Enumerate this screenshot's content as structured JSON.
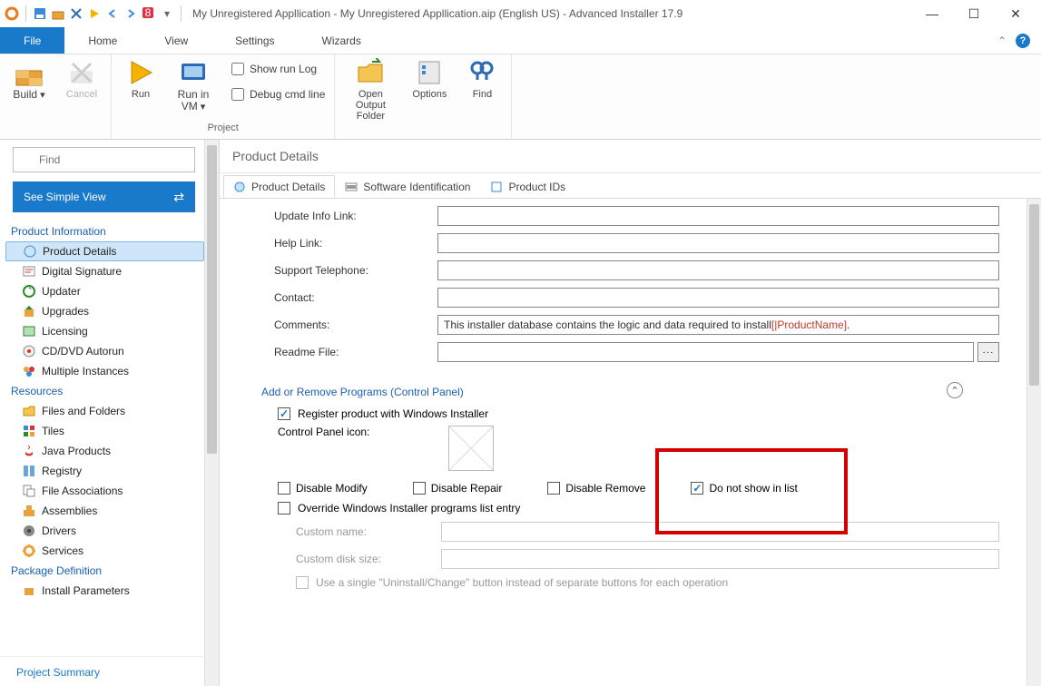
{
  "window": {
    "title": "My Unregistered Appllication - My Unregistered Appllication.aip (English US) - Advanced Installer 17.9"
  },
  "menubar": {
    "file": "File",
    "home": "Home",
    "view": "View",
    "settings": "Settings",
    "wizards": "Wizards"
  },
  "ribbon": {
    "build": "Build",
    "cancel": "Cancel",
    "run": "Run",
    "run_in_vm": "Run in VM",
    "show_run_log": "Show run Log",
    "debug_cmd": "Debug cmd line",
    "open_output": "Open Output Folder",
    "options": "Options",
    "find": "Find",
    "group_project": "Project"
  },
  "left": {
    "find_placeholder": "Find",
    "simple_view": "See Simple View",
    "hdr_product_info": "Product Information",
    "items_product_info": [
      "Product Details",
      "Digital Signature",
      "Updater",
      "Upgrades",
      "Licensing",
      "CD/DVD Autorun",
      "Multiple Instances"
    ],
    "hdr_resources": "Resources",
    "items_resources": [
      "Files and Folders",
      "Tiles",
      "Java Products",
      "Registry",
      "File Associations",
      "Assemblies",
      "Drivers",
      "Services"
    ],
    "hdr_package_def": "Package Definition",
    "items_package_def": [
      "Install Parameters"
    ],
    "project_summary": "Project Summary"
  },
  "main": {
    "header": "Product Details",
    "tabs": [
      "Product Details",
      "Software Identification",
      "Product IDs"
    ],
    "fields": {
      "update_info_link": "Update Info Link:",
      "help_link": "Help Link:",
      "support_tel": "Support Telephone:",
      "contact": "Contact:",
      "comments": "Comments:",
      "comments_val_pre": "This installer database contains the logic and data required to install ",
      "comments_val_red": "[|ProductName]",
      "comments_val_post": ".",
      "readme": "Readme File:"
    },
    "section_arp": "Add or Remove Programs (Control Panel)",
    "arp": {
      "register": "Register product with Windows Installer",
      "cp_icon_label": "Control Panel icon:",
      "disable_modify": "Disable Modify",
      "disable_repair": "Disable Repair",
      "disable_remove": "Disable Remove",
      "do_not_show": "Do not show in list",
      "override": "Override Windows Installer programs list entry",
      "custom_name": "Custom name:",
      "custom_disk": "Custom disk size:",
      "single_button": "Use a single \"Uninstall/Change\" button instead of separate buttons for each operation"
    }
  }
}
